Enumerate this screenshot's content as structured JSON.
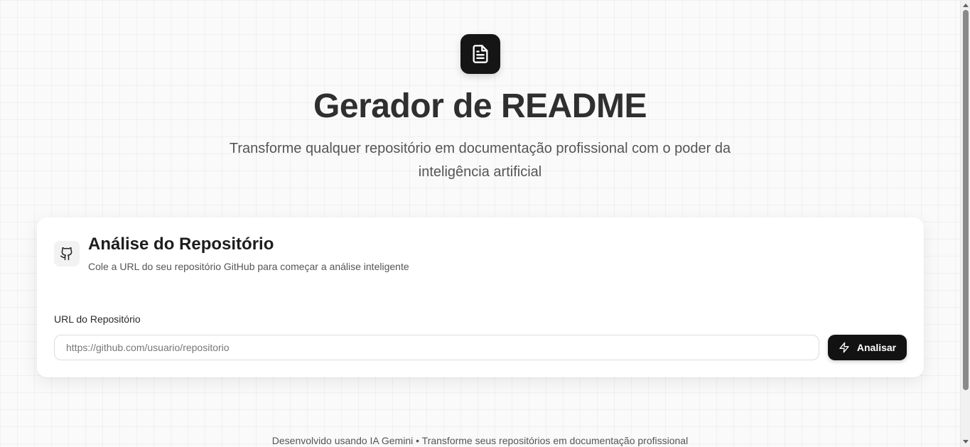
{
  "header": {
    "logo_icon": "document-icon",
    "title": "Gerador de README",
    "subtitle": "Transforme qualquer repositório em documentação profissional com o poder da inteligência artificial"
  },
  "card": {
    "icon": "github-icon",
    "title": "Análise do Repositório",
    "description": "Cole a URL do seu repositório GitHub para começar a análise inteligente",
    "field_label": "URL do Repositório",
    "input_value": "",
    "input_placeholder": "https://github.com/usuario/repositorio",
    "button_icon": "zap-icon",
    "button_label": "Analisar"
  },
  "footer": {
    "text": "Desenvolvido usando IA Gemini • Transforme seus repositórios em documentação profissional"
  },
  "colors": {
    "primary": "#121212",
    "background": "#fafafa",
    "card": "#ffffff"
  }
}
